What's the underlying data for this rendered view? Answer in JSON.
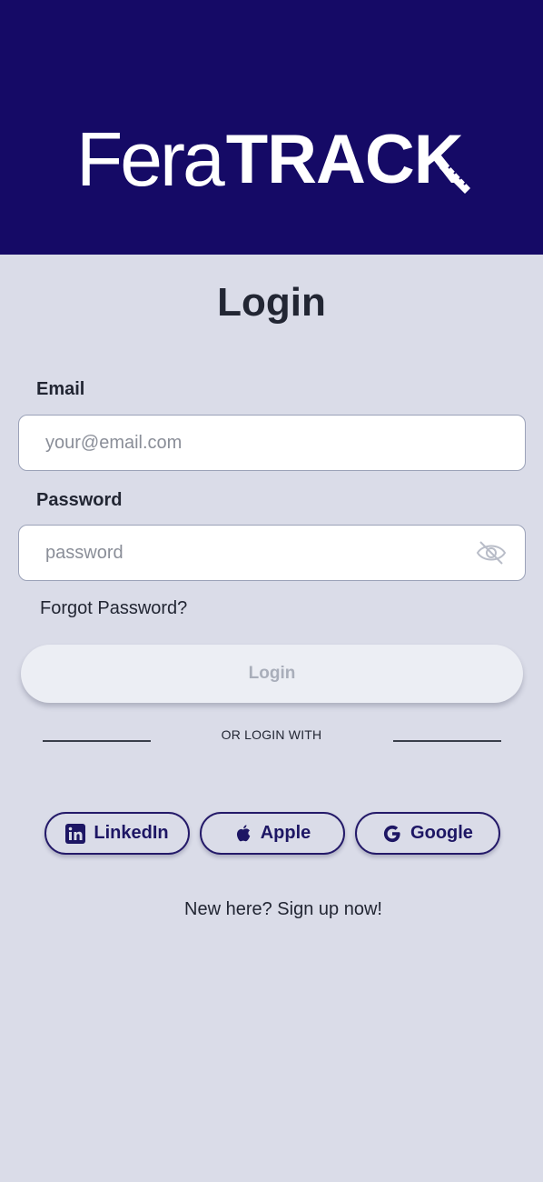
{
  "theme": {
    "header_bg": "#150a66",
    "page_bg": "#dadce8",
    "accent": "#1d1664",
    "button_disabled_bg": "#eceef4",
    "button_disabled_text": "#a9aeba"
  },
  "header": {
    "logo_light": "Fera",
    "logo_bold": "TRACK"
  },
  "page": {
    "title": "Login"
  },
  "form": {
    "email": {
      "label": "Email",
      "value": "",
      "placeholder": "your@email.com"
    },
    "password": {
      "label": "Password",
      "value": "",
      "placeholder": "password",
      "toggle_icon": "eye-off-icon"
    },
    "forgot_label": "Forgot Password?",
    "submit_label": "Login",
    "submit_state": "disabled"
  },
  "social": {
    "divider_text": "OR LOGIN WITH",
    "buttons": [
      {
        "label": "LinkedIn",
        "icon": "linkedin-icon"
      },
      {
        "label": "Apple",
        "icon": "apple-icon"
      },
      {
        "label": "Google",
        "icon": "google-icon"
      }
    ]
  },
  "footer": {
    "signup_label": "New here? Sign up now!"
  }
}
